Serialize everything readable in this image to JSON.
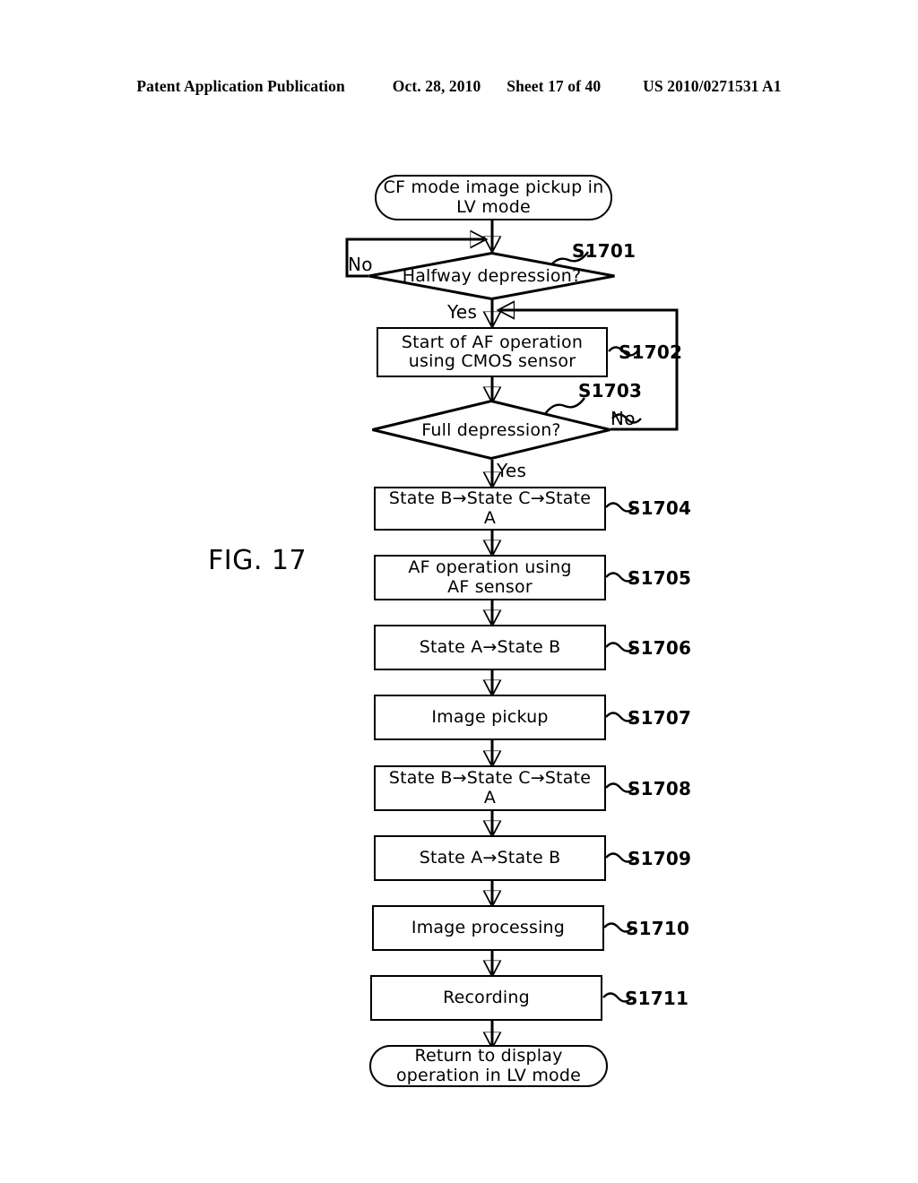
{
  "header": {
    "publication": "Patent Application Publication",
    "date": "Oct. 28, 2010",
    "sheet": "Sheet 17 of 40",
    "patent_number": "US 2010/0271531 A1"
  },
  "figure": {
    "label": "FIG. 17"
  },
  "flowchart": {
    "nodes": [
      {
        "id": "start",
        "type": "terminator",
        "text": "CF mode image pickup in\nLV mode",
        "step": ""
      },
      {
        "id": "s1701",
        "type": "decision",
        "text": "Halfway depression?",
        "step": "S1701"
      },
      {
        "id": "s1702",
        "type": "process",
        "text": "Start of AF operation\nusing CMOS sensor",
        "step": "S1702"
      },
      {
        "id": "s1703",
        "type": "decision",
        "text": "Full depression?",
        "step": "S1703"
      },
      {
        "id": "s1704",
        "type": "process",
        "text": "State B→State C→State A",
        "step": "S1704"
      },
      {
        "id": "s1705",
        "type": "process",
        "text": "AF operation using\nAF sensor",
        "step": "S1705"
      },
      {
        "id": "s1706",
        "type": "process",
        "text": "State A→State B",
        "step": "S1706"
      },
      {
        "id": "s1707",
        "type": "process",
        "text": "Image pickup",
        "step": "S1707"
      },
      {
        "id": "s1708",
        "type": "process",
        "text": "State B→State C→State A",
        "step": "S1708"
      },
      {
        "id": "s1709",
        "type": "process",
        "text": "State A→State B",
        "step": "S1709"
      },
      {
        "id": "s1710",
        "type": "process",
        "text": "Image processing",
        "step": "S1710"
      },
      {
        "id": "s1711",
        "type": "process",
        "text": "Recording",
        "step": "S1711"
      },
      {
        "id": "end",
        "type": "terminator",
        "text": "Return to display\noperation in LV mode",
        "step": ""
      }
    ],
    "branch_labels": {
      "s1701_no": "No",
      "s1701_yes": "Yes",
      "s1703_no": "No",
      "s1703_yes": "Yes"
    }
  }
}
